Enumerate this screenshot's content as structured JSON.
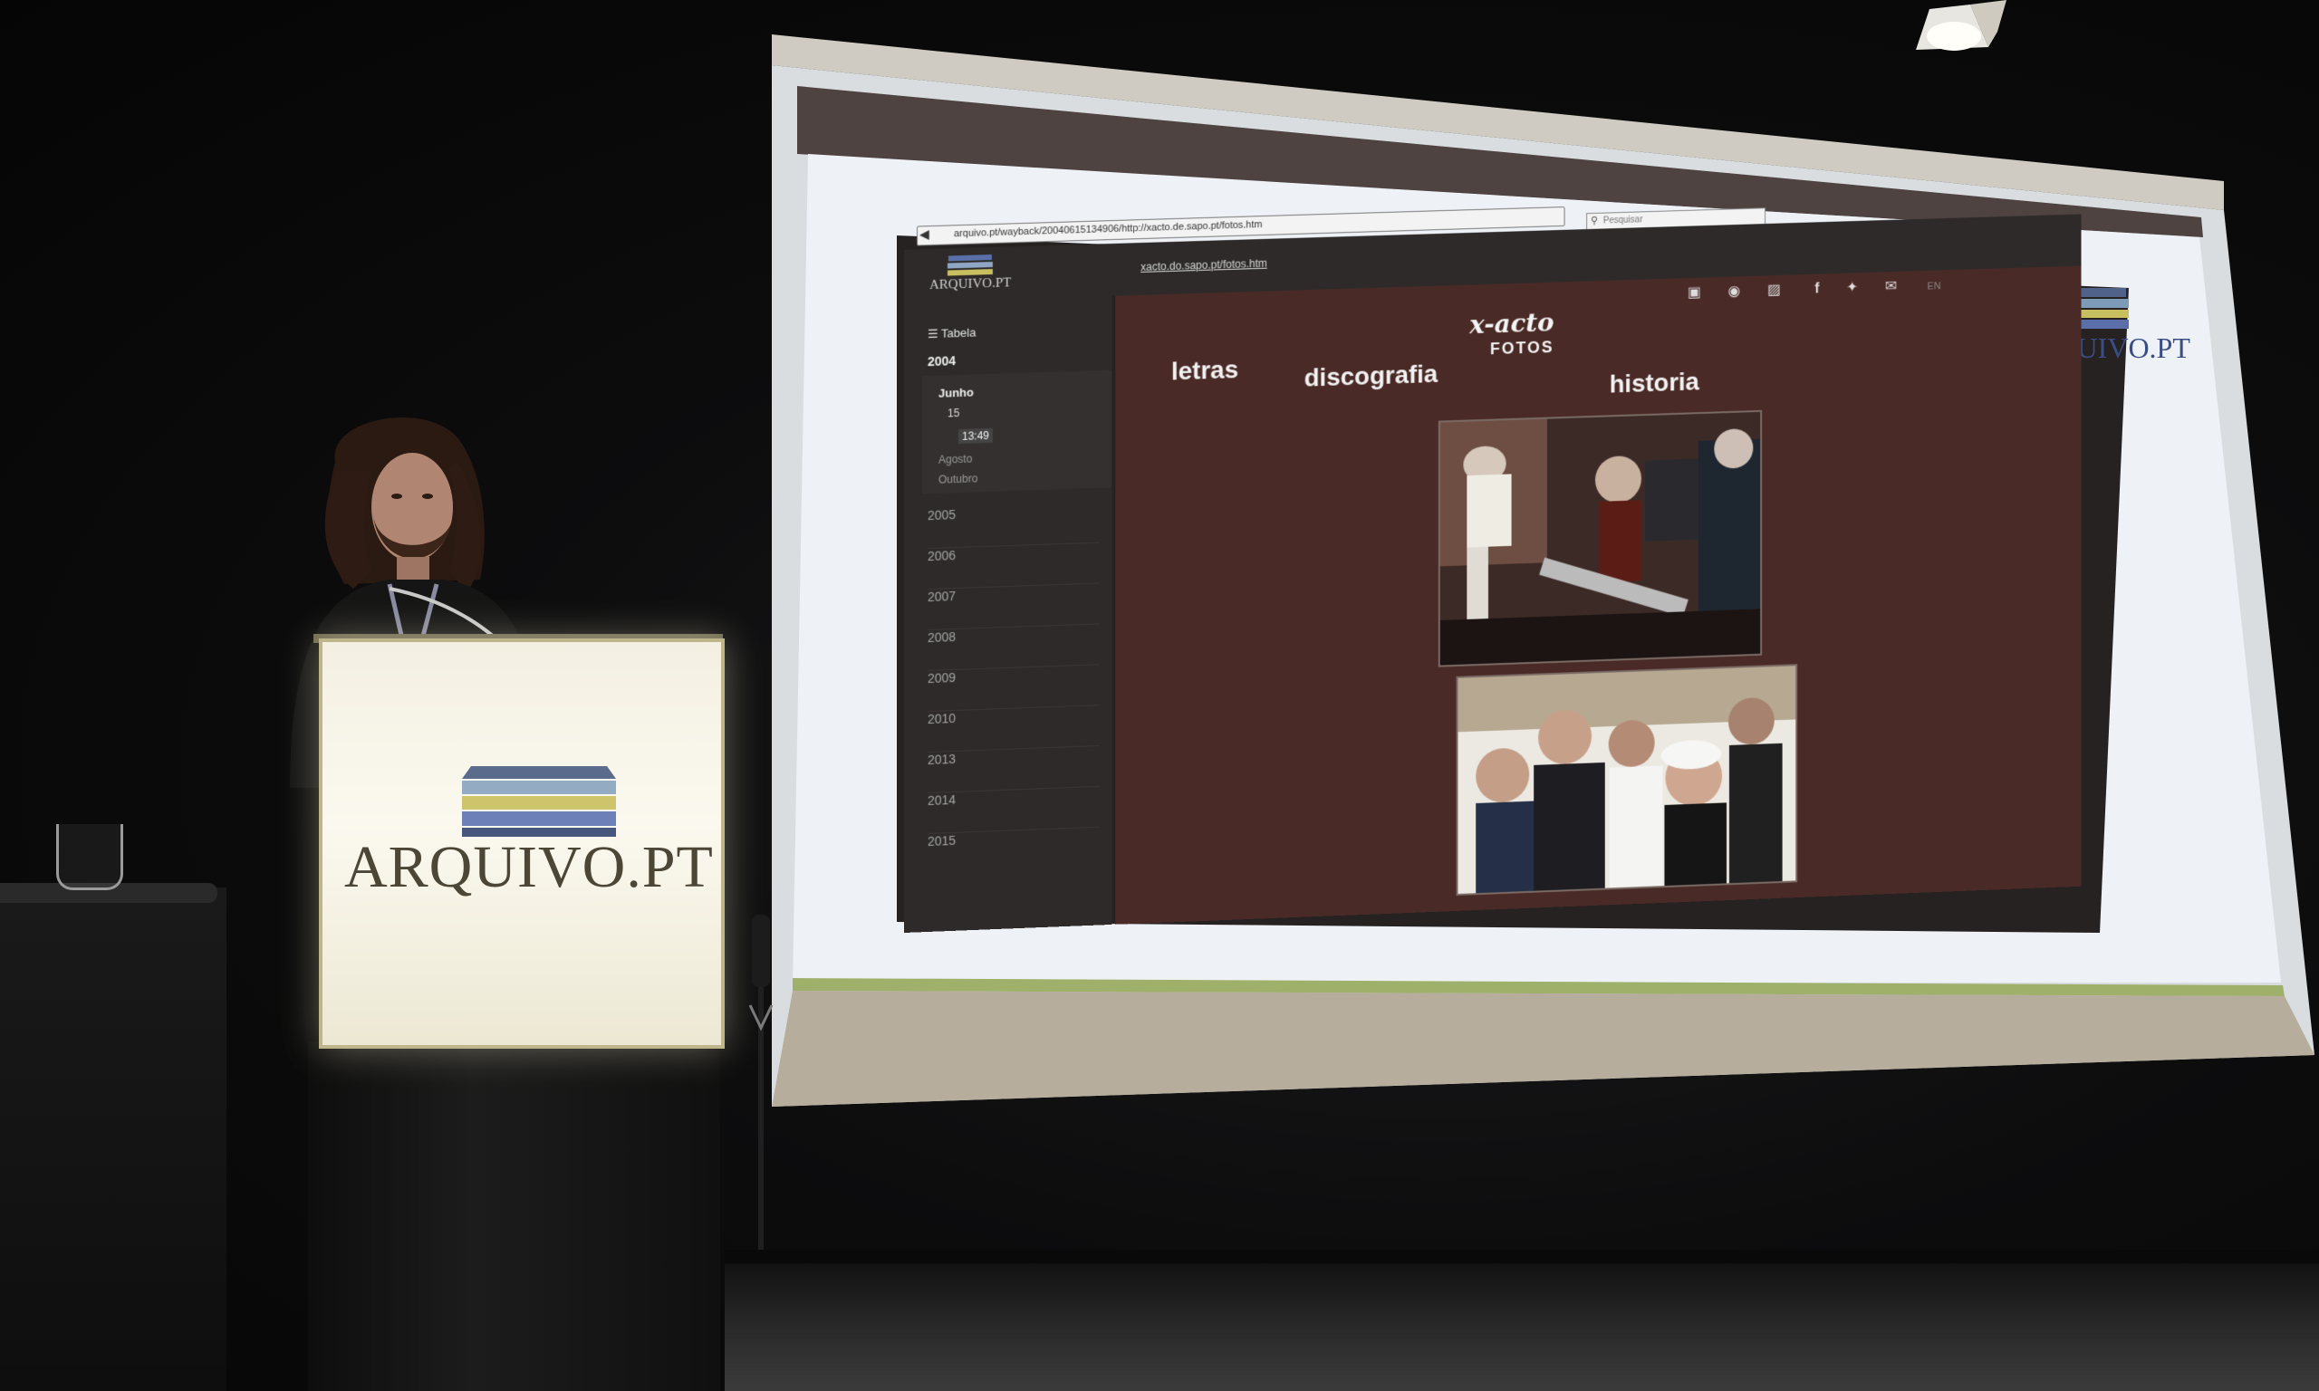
{
  "browser": {
    "url": "arquivo.pt/wayback/20040615134906/http://xacto.de.sapo.pt/fotos.htm",
    "search_placeholder": "Pesquisar"
  },
  "archive_bar": {
    "logo_text": "ARQUIVO.PT",
    "archived_link": "xacto.do.sapo.pt/fotos.htm",
    "language": "EN",
    "icons": [
      "image-icon",
      "camera-icon",
      "print-icon",
      "facebook-icon",
      "twitter-icon",
      "mail-icon"
    ]
  },
  "timeline": {
    "view_label": "Tabela",
    "selected_year": "2004",
    "month": "Junho",
    "day": "15",
    "time": "13:49",
    "other_months": [
      "Agosto",
      "Outubro"
    ],
    "years": [
      "2005",
      "2006",
      "2007",
      "2008",
      "2009",
      "2010",
      "2013",
      "2014",
      "2015"
    ]
  },
  "archived_page": {
    "logo": "x-acto",
    "subtitle": "FOTOS",
    "nav": [
      "letras",
      "discografia",
      "historia"
    ],
    "colors": {
      "background": "#4a2a26",
      "nav_text": "#f2f2f2"
    }
  },
  "screen_logo": {
    "text": "ARQUIVO.PT"
  },
  "podium": {
    "logo_text": "ARQUIVO.PT"
  }
}
